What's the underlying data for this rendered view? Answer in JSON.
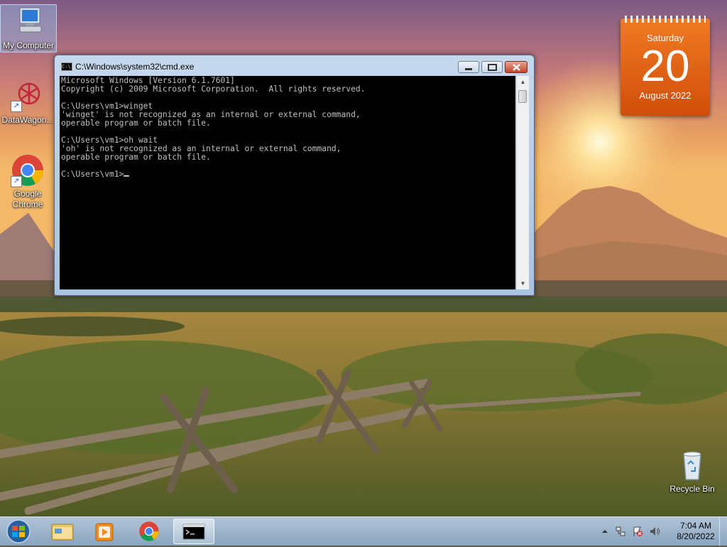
{
  "desktop": {
    "icons": [
      {
        "label": "My Computer",
        "icon": "computer-icon"
      },
      {
        "label": "DataWagon...",
        "icon": "datawagon-icon"
      },
      {
        "label": "Google Chrome",
        "icon": "chrome-icon"
      },
      {
        "label": "Recycle Bin",
        "icon": "recycle-bin-icon"
      }
    ]
  },
  "calendar": {
    "weekday": "Saturday",
    "day": "20",
    "month_year": "August 2022",
    "accent": "#e8640f"
  },
  "cmd": {
    "title": "C:\\Windows\\system32\\cmd.exe",
    "icon_text": "C:\\",
    "lines": [
      "Microsoft Windows [Version 6.1.7601]",
      "Copyright (c) 2009 Microsoft Corporation.  All rights reserved.",
      "",
      "C:\\Users\\vm1>winget",
      "'winget' is not recognized as an internal or external command,",
      "operable program or batch file.",
      "",
      "C:\\Users\\vm1>oh wait",
      "'oh' is not recognized as an internal or external command,",
      "operable program or batch file.",
      "",
      "C:\\Users\\vm1>"
    ],
    "foreground": "#c0c0c0",
    "background": "#000000"
  },
  "taskbar": {
    "pinned": [
      "start-orb-icon",
      "explorer-icon",
      "media-player-icon",
      "chrome-icon",
      "cmd-icon"
    ],
    "active": "cmd-icon",
    "tray_icons": [
      "show-hidden-icons-icon",
      "network-icon",
      "action-center-icon",
      "volume-icon"
    ],
    "time": "7:04 AM",
    "date": "8/20/2022"
  }
}
